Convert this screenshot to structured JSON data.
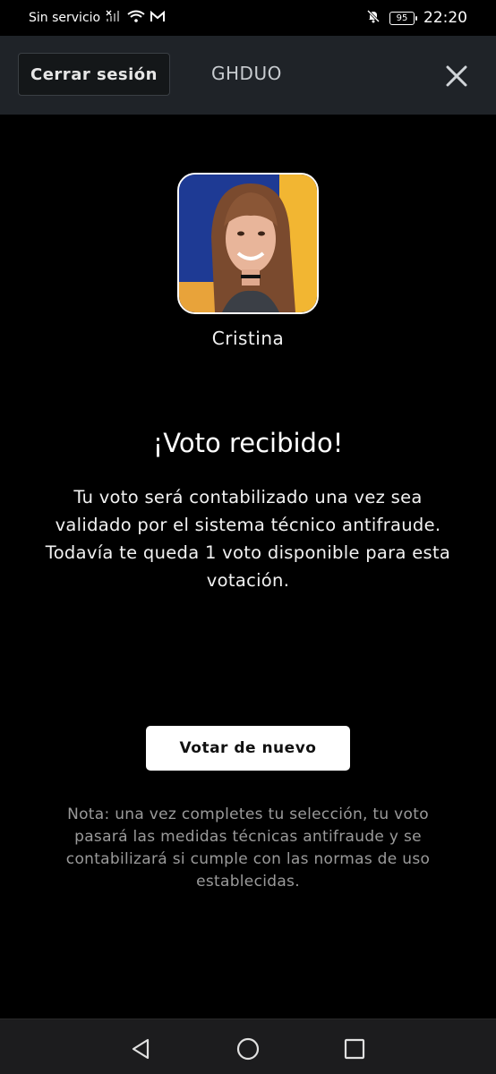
{
  "status_bar": {
    "carrier": "Sin servicio",
    "battery": "95",
    "time": "22:20",
    "icons": [
      "no-signal-icon",
      "wifi-icon",
      "gmail-icon",
      "mute-icon",
      "battery-icon"
    ]
  },
  "header": {
    "logout_label": "Cerrar sesión",
    "title": "GHDUO",
    "close_icon": "close-icon"
  },
  "candidate": {
    "name": "Cristina"
  },
  "confirmation": {
    "headline": "¡Voto recibido!",
    "message": "Tu voto será contabilizado una vez sea validado por el sistema técnico antifraude. Todavía te queda 1 voto disponible para esta votación.",
    "vote_again_label": "Votar de nuevo",
    "note": "Nota: una vez completes tu selección, tu voto pasará las medidas técnicas antifraude y se contabilizará si cumple con las normas de uso establecidas."
  },
  "nav": {
    "icons": [
      "back-icon",
      "home-icon",
      "recents-icon"
    ]
  },
  "colors": {
    "background": "#000000",
    "header_bg": "#1f2328",
    "button_bg": "#ffffff",
    "note_text": "#9a9a9a"
  }
}
